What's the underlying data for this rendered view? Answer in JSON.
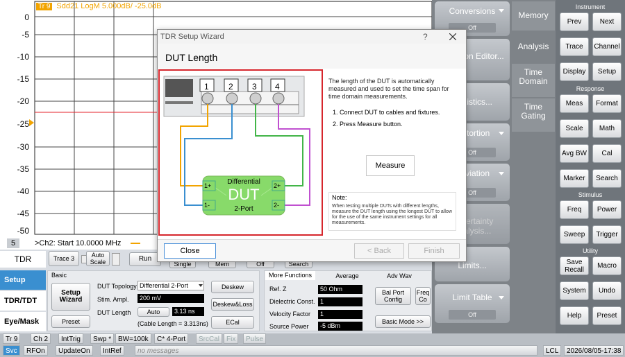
{
  "trace_header": {
    "badge": "Tr 9",
    "text": "Sdd21 LogM 5.000dB/ -25.0dB"
  },
  "y_ticks": [
    "0",
    "-5",
    "-10",
    "-15",
    "-20",
    "-25",
    "-30",
    "-35",
    "-40",
    "-45",
    "-50"
  ],
  "plot_footer": {
    "channel": "5",
    "start": ">Ch2:  Start   10.0000 MHz"
  },
  "colors": {
    "trace": "#f2a400",
    "ref": "#e6202a"
  },
  "right_panels": {
    "conversions": {
      "label": "Conversions",
      "sub": "Off"
    },
    "equation": {
      "label": "Equation Editor..."
    },
    "statistics": {
      "label": "Statistics..."
    },
    "distortion": {
      "label": "Distortion",
      "sub": "Off"
    },
    "deviation": {
      "label": "Deviation",
      "sub": "Off"
    },
    "uncertainty": {
      "label": "Uncertainty Analysis..."
    },
    "limits": {
      "label": "Limits..."
    },
    "limit_table": {
      "label": "Limit Table",
      "sub": "Off"
    }
  },
  "tabs": [
    "Memory",
    "Analysis",
    "Time Domain",
    "Time Gating"
  ],
  "instrument": {
    "title": "Instrument",
    "row1": [
      "Prev",
      "Next"
    ],
    "row2": [
      "Trace",
      "Channel"
    ],
    "row3": [
      "Display",
      "Setup"
    ],
    "response_title": "Response",
    "row4": [
      "Meas",
      "Format"
    ],
    "row5": [
      "Scale",
      "Math"
    ],
    "row6": [
      "Avg BW",
      "Cal"
    ],
    "row7": [
      "Marker",
      "Search"
    ],
    "stimulus_title": "Stimulus",
    "row8": [
      "Freq",
      "Power"
    ],
    "row9": [
      "Sweep",
      "Trigger"
    ],
    "utility_title": "Utility",
    "row10": [
      "Save Recall",
      "Macro"
    ],
    "row11": [
      "System",
      "Undo"
    ],
    "row12": [
      "Help",
      "Preset"
    ]
  },
  "bottom": {
    "tdr_label": "TDR",
    "trace_dd": "Trace 3",
    "autoscale": "Auto Scale",
    "run": "Run",
    "single": "Single",
    "mem": "Mem",
    "off": "Off",
    "search": "Search",
    "left_tabs": [
      "Setup",
      "TDR/TDT",
      "Eye/Mask"
    ],
    "basic": "Basic",
    "setup_wizard": "Setup Wizard",
    "preset": "Preset",
    "dut_topology_label": "DUT Topology",
    "dut_topology_value": "Differential 2-Port",
    "stim_ampl_label": "Stim. Ampl.",
    "stim_ampl_value": "200 mV",
    "dut_length_label": "DUT Length",
    "dut_length_auto": "Auto",
    "dut_length_value": "3.13 ns",
    "cable_length": "(Cable Length = 3.313ns)",
    "deskew": "Deskew",
    "deskew_loss": "Deskew&Loss",
    "ecal": "ECal",
    "more_functions": "More Functions",
    "average": "Average",
    "adv_wav": "Adv Wav",
    "ref_z_label": "Ref. Z",
    "ref_z_value": "50 Ohm",
    "dielectric_label": "Dielectric Const.",
    "dielectric_value": "1",
    "velocity_label": "Velocity Factor",
    "velocity_value": "1",
    "source_power_label": "Source Power",
    "source_power_value": "-5 dBm",
    "bal_port": "Bal Port Config",
    "freq_c": "Freq Co",
    "basic_mode": "Basic Mode >>"
  },
  "status1": [
    "Tr 9",
    "Ch 2",
    "IntTrig",
    "Swp *",
    "BW=100k",
    "C* 4-Port",
    "SrcCal",
    "Fix",
    "Pulse"
  ],
  "status2": {
    "svc": "Svc",
    "rfon": "RFOn",
    "update": "UpdateOn",
    "intref": "IntRef",
    "msg": "no messages",
    "lcl": "LCL",
    "datetime": "2026/08/05-17:38"
  },
  "dialog": {
    "title": "TDR Setup Wizard",
    "help": "?",
    "heading": "DUT Length",
    "description": "The length of the DUT is automatically measured and used to set the time span for time domain measurements.",
    "step1": "1. Connect DUT to cables and fixtures.",
    "step2": "2. Press Measure button.",
    "measure": "Measure",
    "note_title": "Note:",
    "note_text": "When testing multiple DUTs with different lengths, measure the DUT length using the longest DUT to allow for the use of the same instrument settings for all measurements.",
    "close": "Close",
    "back": "< Back",
    "finish": "Finish",
    "ports": [
      "1",
      "2",
      "3",
      "4"
    ],
    "dut_title": "Differential",
    "dut_big": "DUT",
    "dut_sub": "2-Port",
    "pins": [
      "1+",
      "1-",
      "2+",
      "2-"
    ]
  }
}
